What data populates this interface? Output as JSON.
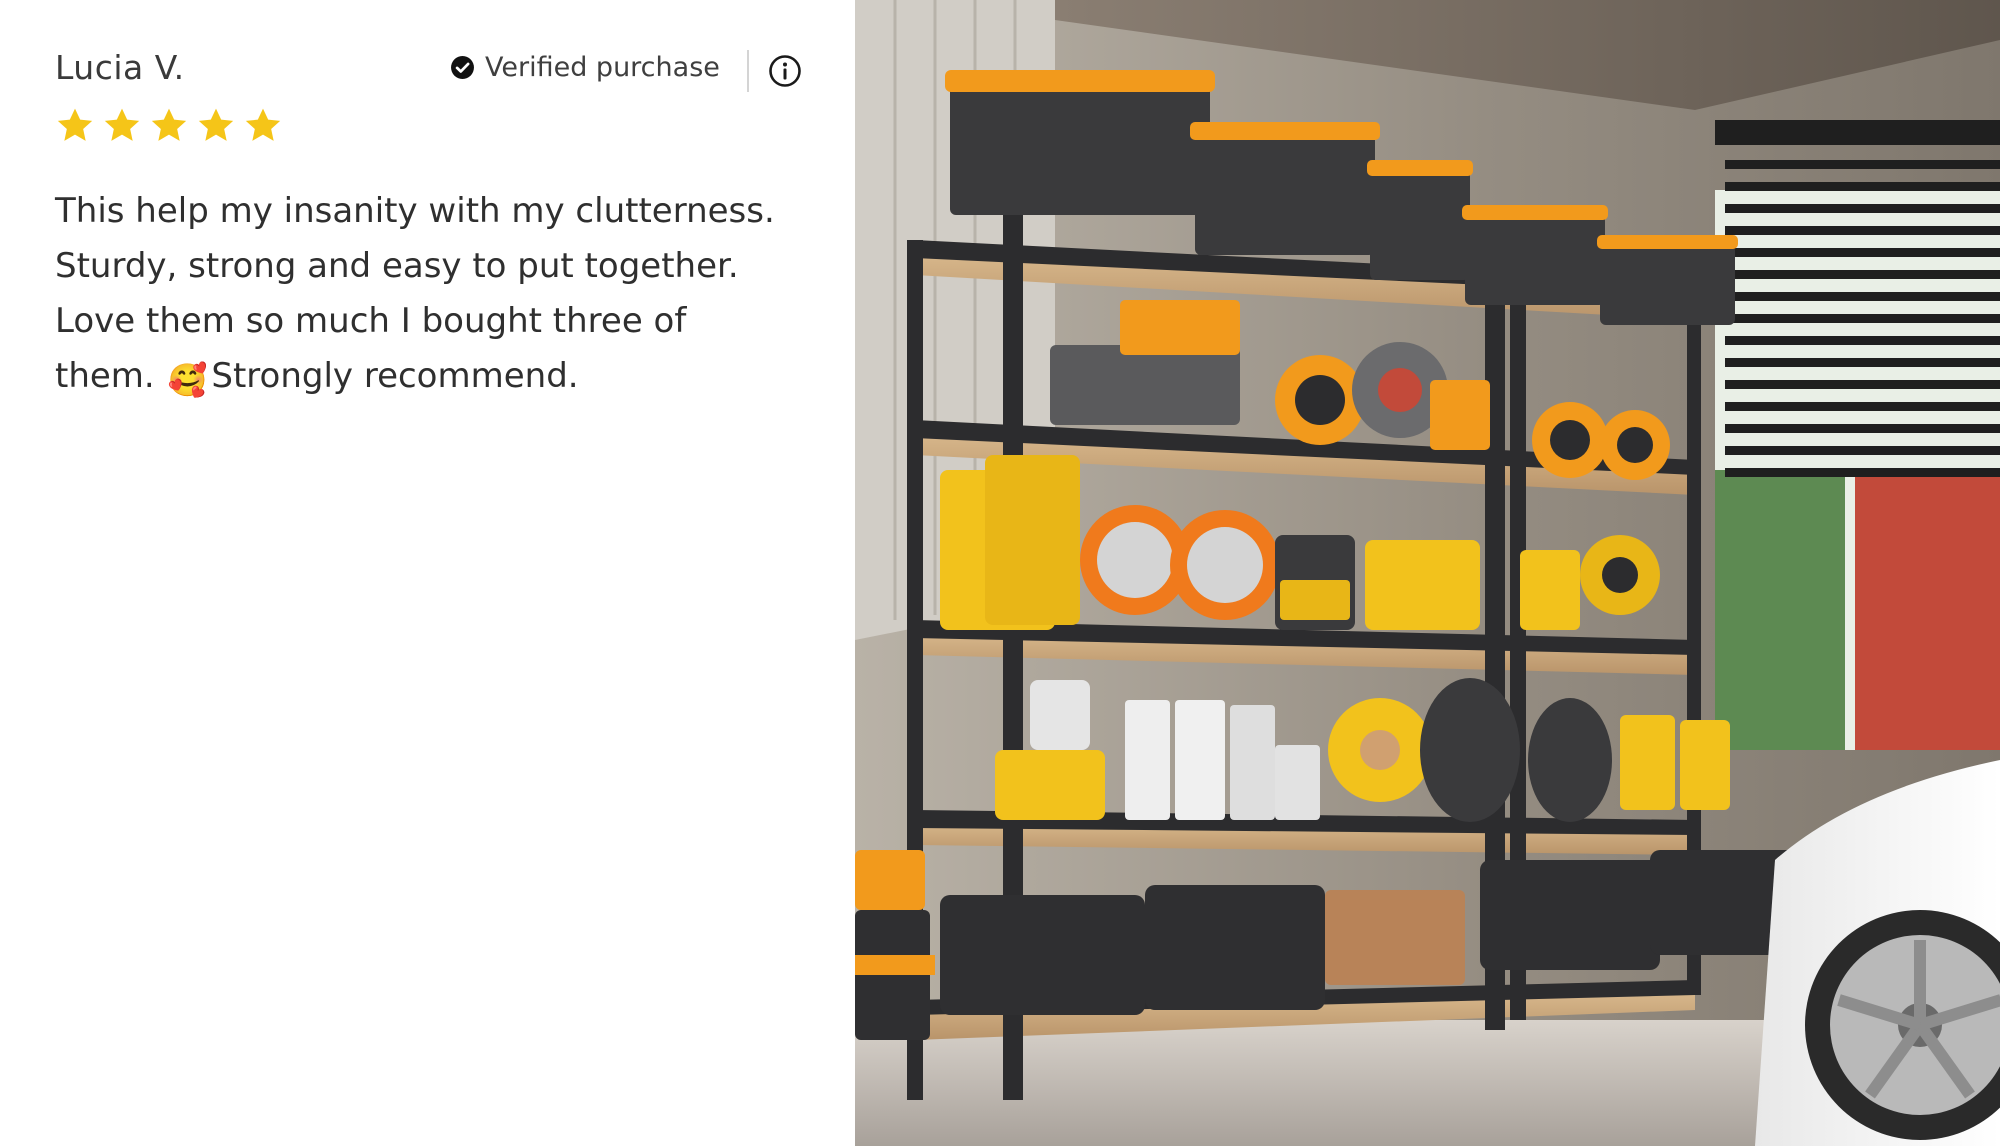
{
  "review": {
    "reviewer_name": "Lucia V.",
    "verified_label": "Verified purchase",
    "rating": 5,
    "rating_max": 5,
    "star_color": "#f5c518",
    "text_part1": "This help my insanity with my clutterness. Sturdy, strong and easy to put together. Love them so much I bought three of them.",
    "emoji": "🥰",
    "text_part2": "Strongly recommend."
  },
  "icons": {
    "verified": "check-circle-icon",
    "info": "info-icon",
    "star": "star-icon"
  },
  "product_photo": {
    "subject": "garage storage shelving units",
    "colors": {
      "shelf_frame": "#2c2c2e",
      "bins_lid": "#f29a1c",
      "shelf_board": "#c9a57a",
      "wall": "#9c958a",
      "floor": "#cfc8c1"
    }
  }
}
